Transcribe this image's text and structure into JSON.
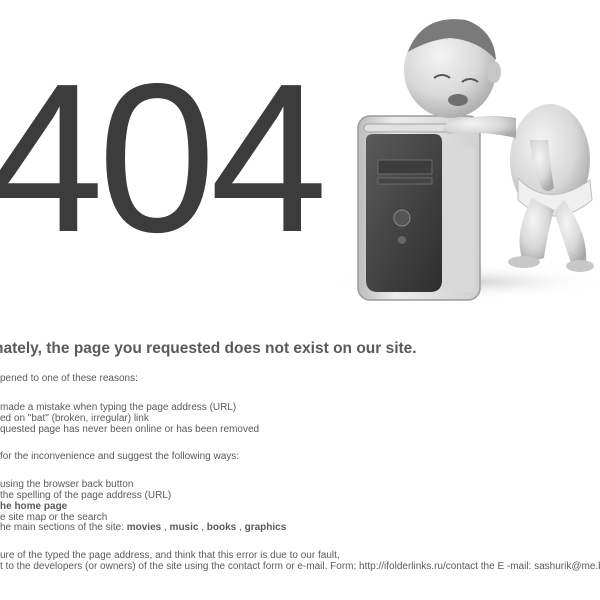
{
  "error_code": "404",
  "headline": "nately, the page you requested does not exist on our site.",
  "reasons_intro": "pened to one of these reasons:",
  "reasons": [
    "made a mistake when typing the page address (URL)",
    "ed on \"bat\" (broken, irregular) link",
    "quested page has never been online or has been removed"
  ],
  "apology": "for the inconvenience and suggest the following ways:",
  "ways": {
    "back": "using the browser back button",
    "spelling": "the spelling of the page address (URL)",
    "home": "he home page",
    "sitemap": "e site map or the search",
    "sections_prefix": "he main sections of the site: ",
    "sections": [
      "movies",
      "music",
      "books",
      "graphics"
    ],
    "separator": " , "
  },
  "footer": {
    "line1": "ure of the typed the page address, and think that this error is due to our fault,",
    "line2": "t to the developers (or owners) of the site using the contact form or e-mail. Form: http://ifolderlinks.ru/contact the E -mail: sashurik@me.by"
  },
  "illustration": {
    "icon": "crying-baby-leaning-on-computer"
  }
}
